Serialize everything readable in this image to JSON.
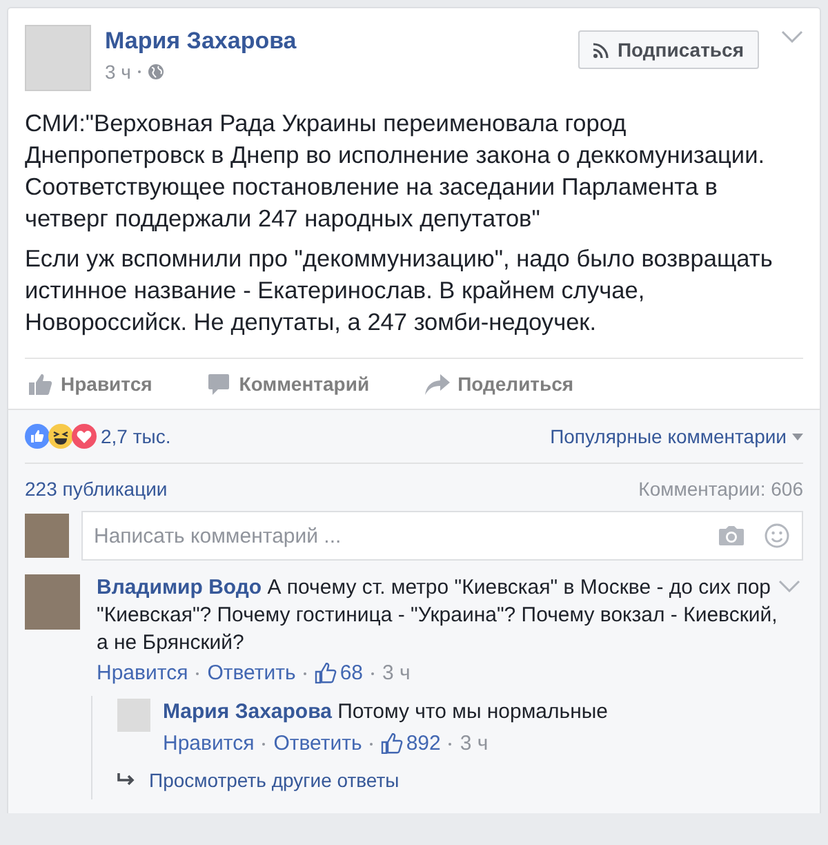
{
  "post": {
    "author": "Мария Захарова",
    "time": "3 ч",
    "follow_button": "Подписаться",
    "paragraphs": [
      "СМИ:\"Верховная Рада Украины переименовала город Днепропетровск в Днепр во исполнение закона о деккомунизации. Соответствующее постановление на заседании Парламента в четверг поддержали 247 народных депутатов\"",
      "Если уж вспомнили про \"декоммунизацию\", надо было возвращать истинное название - Екатеринослав. В крайнем случае, Новороссийск. Не депутаты, а 247 зомби-недоучек."
    ]
  },
  "actions": [
    {
      "kind": "like",
      "label": "Нравится"
    },
    {
      "kind": "comment",
      "label": "Комментарий"
    },
    {
      "kind": "share",
      "label": "Поделиться"
    }
  ],
  "reactions": {
    "items": [
      {
        "kind": "like"
      },
      {
        "kind": "haha"
      },
      {
        "kind": "love"
      }
    ],
    "count": "2,7 тыс.",
    "sort": "Популярные комментарии"
  },
  "stats": {
    "shares": "223 публикации",
    "comments": "Комментарии: 606"
  },
  "composer": {
    "placeholder": "Написать комментарий ..."
  },
  "comments": [
    {
      "author": "Владимир Водо",
      "text": "А почему ст. метро \"Киевская\" в Москве - до сих пор \"Киевская\"? Почему гостиница - \"Украина\"? Почему вокзал - Киевский, а не Брянский?",
      "like": "Нравится",
      "reply": "Ответить",
      "likes": "68",
      "time": "3 ч",
      "replies": [
        {
          "author": "Мария Захарова",
          "text": "Потому что мы нормальные",
          "like": "Нравится",
          "reply": "Ответить",
          "likes": "892",
          "time": "3 ч"
        }
      ],
      "more_replies": "Просмотреть другие ответы"
    }
  ]
}
